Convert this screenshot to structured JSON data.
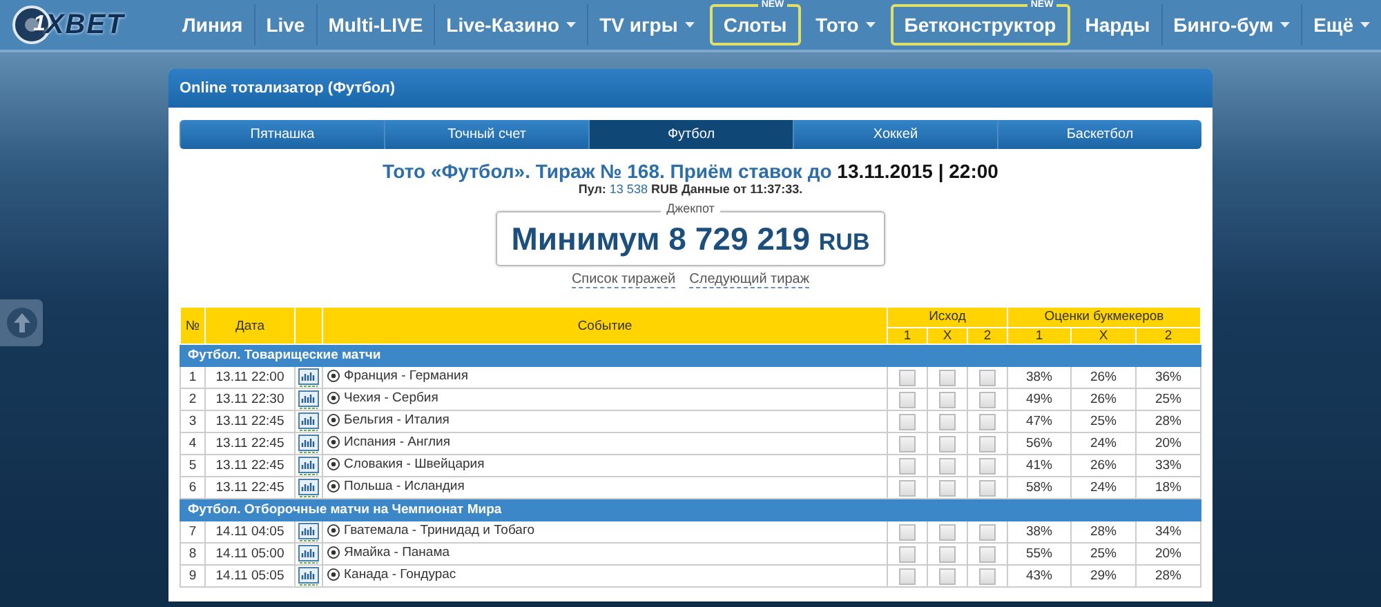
{
  "logo": {
    "number": "1",
    "word": "XBET"
  },
  "nav": [
    {
      "label": "Линия",
      "dropdown": false,
      "highlighted": false
    },
    {
      "label": "Live",
      "dropdown": false,
      "highlighted": false
    },
    {
      "label": "Multi-LIVE",
      "dropdown": false,
      "highlighted": false
    },
    {
      "label": "Live-Казино",
      "dropdown": true,
      "highlighted": false
    },
    {
      "label": "TV игры",
      "dropdown": true,
      "highlighted": false
    },
    {
      "label": "Слоты",
      "dropdown": false,
      "highlighted": true,
      "badge": "NEW"
    },
    {
      "label": "Тото",
      "dropdown": true,
      "highlighted": false
    },
    {
      "label": "Бетконструктор",
      "dropdown": false,
      "highlighted": true,
      "badge": "NEW"
    },
    {
      "label": "Нарды",
      "dropdown": false,
      "highlighted": false
    },
    {
      "label": "Бинго-бум",
      "dropdown": true,
      "highlighted": false
    },
    {
      "label": "Ещё",
      "dropdown": true,
      "highlighted": false
    }
  ],
  "panel": {
    "title": "Online тотализатор (Футбол)"
  },
  "tabs": [
    {
      "label": "Пятнашка",
      "selected": false
    },
    {
      "label": "Точный счет",
      "selected": false
    },
    {
      "label": "Футбол",
      "selected": true
    },
    {
      "label": "Хоккей",
      "selected": false
    },
    {
      "label": "Баскетбол",
      "selected": false
    }
  ],
  "draw": {
    "title": "Тото «Футбол». Тираж № 168. Приём ставок до",
    "deadline": "13.11.2015 | 22:00",
    "pool_label": "Пул:",
    "pool_value": "13 538",
    "pool_currency": "RUB Данные от",
    "pool_time": "11:37:33."
  },
  "jackpot": {
    "legend": "Джекпот",
    "amount": "Минимум 8 729 219",
    "currency": "RUB"
  },
  "links": [
    "Список тиражей",
    "Следующий тираж"
  ],
  "table": {
    "columns": {
      "num": "№",
      "date": "Дата",
      "event": "Событие",
      "outcome": "Исход",
      "odds": "Оценки букмекеров",
      "sub": [
        "1",
        "X",
        "2",
        "1",
        "X",
        "2"
      ]
    },
    "sections": [
      {
        "title": "Футбол. Товарищеские матчи",
        "rows": [
          {
            "num": "1",
            "date": "13.11 22:00",
            "event": "Франция - Германия",
            "picks": [
              {
                "checked": false
              },
              {
                "checked": false
              },
              {
                "checked": false
              }
            ],
            "odds": [
              "38%",
              "26%",
              "36%"
            ]
          },
          {
            "num": "2",
            "date": "13.11 22:30",
            "event": "Чехия - Сербия",
            "picks": [
              {
                "checked": false
              },
              {
                "checked": false
              },
              {
                "checked": false
              }
            ],
            "odds": [
              "49%",
              "26%",
              "25%"
            ]
          },
          {
            "num": "3",
            "date": "13.11 22:45",
            "event": "Бельгия - Италия",
            "picks": [
              {
                "checked": false
              },
              {
                "checked": false
              },
              {
                "checked": false
              }
            ],
            "odds": [
              "47%",
              "25%",
              "28%"
            ]
          },
          {
            "num": "4",
            "date": "13.11 22:45",
            "event": "Испания - Англия",
            "picks": [
              {
                "checked": false
              },
              {
                "checked": false
              },
              {
                "checked": false
              }
            ],
            "odds": [
              "56%",
              "24%",
              "20%"
            ]
          },
          {
            "num": "5",
            "date": "13.11 22:45",
            "event": "Словакия - Швейцария",
            "picks": [
              {
                "checked": false
              },
              {
                "checked": false
              },
              {
                "checked": false
              }
            ],
            "odds": [
              "41%",
              "26%",
              "33%"
            ]
          },
          {
            "num": "6",
            "date": "13.11 22:45",
            "event": "Польша - Исландия",
            "picks": [
              {
                "checked": false
              },
              {
                "checked": false
              },
              {
                "checked": false
              }
            ],
            "odds": [
              "58%",
              "24%",
              "18%"
            ]
          }
        ]
      },
      {
        "title": "Футбол. Отборочные матчи на Чемпионат Мира",
        "rows": [
          {
            "num": "7",
            "date": "14.11 04:05",
            "event": "Гватемала - Тринидад и Тобаго",
            "picks": [
              {
                "checked": false
              },
              {
                "checked": false
              },
              {
                "checked": false
              }
            ],
            "odds": [
              "38%",
              "28%",
              "34%"
            ]
          },
          {
            "num": "8",
            "date": "14.11 05:00",
            "event": "Ямайка - Панама",
            "picks": [
              {
                "checked": false
              },
              {
                "checked": false
              },
              {
                "checked": false
              }
            ],
            "odds": [
              "55%",
              "25%",
              "20%"
            ]
          },
          {
            "num": "9",
            "date": "14.11 05:05",
            "event": "Канада - Гондурас",
            "picks": [
              {
                "checked": false
              },
              {
                "checked": false
              },
              {
                "checked": false
              }
            ],
            "odds": [
              "43%",
              "29%",
              "28%"
            ]
          }
        ]
      }
    ]
  }
}
